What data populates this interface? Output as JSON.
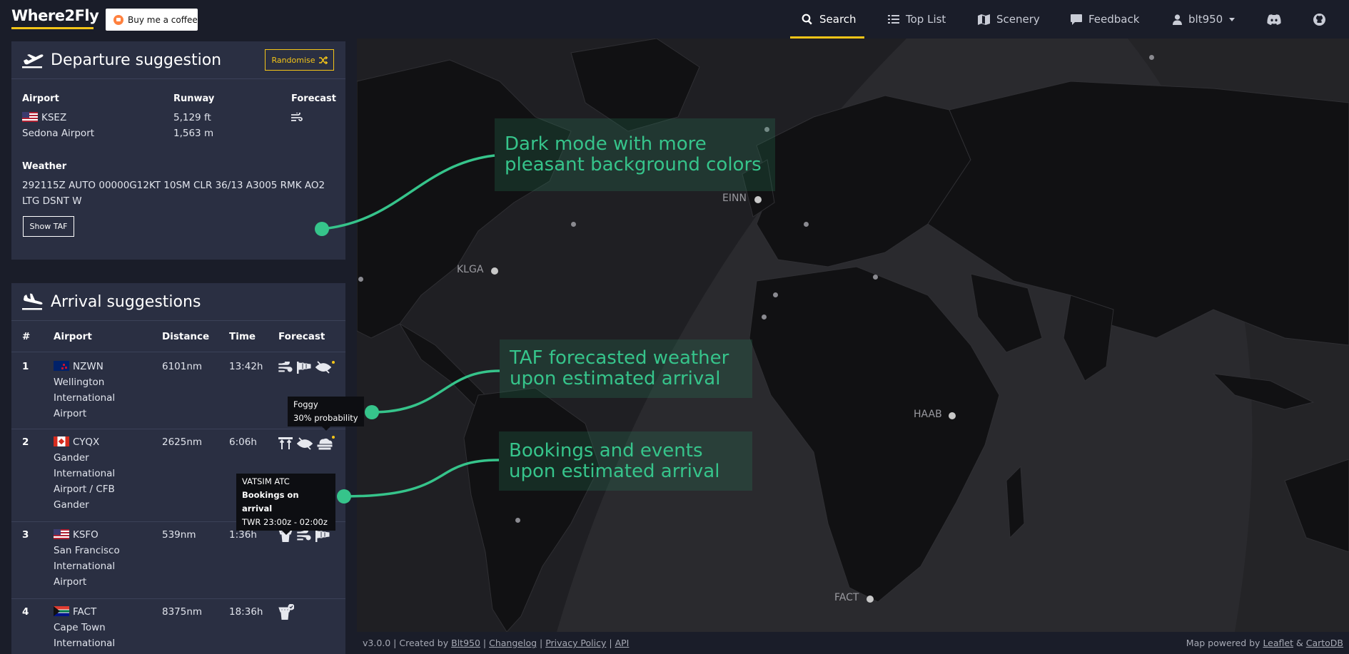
{
  "nav": {
    "brand": "Where2Fly",
    "coffee": "Buy me a coffee",
    "search": "Search",
    "toplist": "Top List",
    "scenery": "Scenery",
    "feedback": "Feedback",
    "user": "blt950"
  },
  "departure": {
    "title": "Departure suggestion",
    "randomise": "Randomise",
    "airport_label": "Airport",
    "runway_label": "Runway",
    "forecast_label": "Forecast",
    "icao": "KSEZ",
    "name": "Sedona Airport",
    "runway_ft": "5,129 ft",
    "runway_m": "1,563 m",
    "weather_label": "Weather",
    "metar_line1": "292115Z AUTO 00000G12KT 10SM CLR 36/13 A3005 RMK AO2",
    "metar_line2": "LTG DSNT W",
    "show_taf": "Show TAF"
  },
  "arrivals": {
    "title": "Arrival suggestions",
    "headers": [
      "#",
      "Airport",
      "Distance",
      "Time",
      "Forecast"
    ],
    "rows": [
      {
        "n": "1",
        "icao": "NZWN",
        "name": [
          "Wellington",
          "International",
          "Airport"
        ],
        "distance": "6101nm",
        "time": "13:42h"
      },
      {
        "n": "2",
        "icao": "CYQX",
        "name": [
          "Gander",
          "International",
          "Airport / CFB",
          "Gander"
        ],
        "distance": "2625nm",
        "time": "6:06h"
      },
      {
        "n": "3",
        "icao": "KSFO",
        "name": [
          "San Francisco",
          "International",
          "Airport"
        ],
        "distance": "539nm",
        "time": "1:36h"
      },
      {
        "n": "4",
        "icao": "FACT",
        "name": [
          "Cape Town",
          "International"
        ],
        "distance": "8375nm",
        "time": "18:36h"
      }
    ]
  },
  "tooltips": {
    "foggy_title": "Foggy",
    "foggy_prob": "30% probability",
    "atc_title": "VATSIM ATC",
    "atc_sub": "Bookings on arrival",
    "atc_time": "TWR 23:00z - 02:00z"
  },
  "map": {
    "labels": [
      "EINN",
      "KLGA",
      "HAAB",
      "FACT"
    ]
  },
  "callouts": {
    "dark_l1": "Dark mode with more",
    "dark_l2": "pleasant background colors",
    "taf_l1": "TAF forecasted weather",
    "taf_l2": "upon estimated arrival",
    "book_l1": "Bookings and events",
    "book_l2": "upon estimated arrival"
  },
  "footer": {
    "version": "v3.0.0 | Created by",
    "author": "Blt950",
    "changelog": "Changelog",
    "privacy": "Privacy Policy",
    "api": "API",
    "powered": "Map powered by",
    "leaflet": "Leaflet",
    "amp": "&",
    "carto": "CartoDB"
  },
  "colors": {
    "accent": "#f5c518",
    "callout": "#36c48b",
    "panel": "#2a2f42",
    "bg": "#1a1d29"
  }
}
